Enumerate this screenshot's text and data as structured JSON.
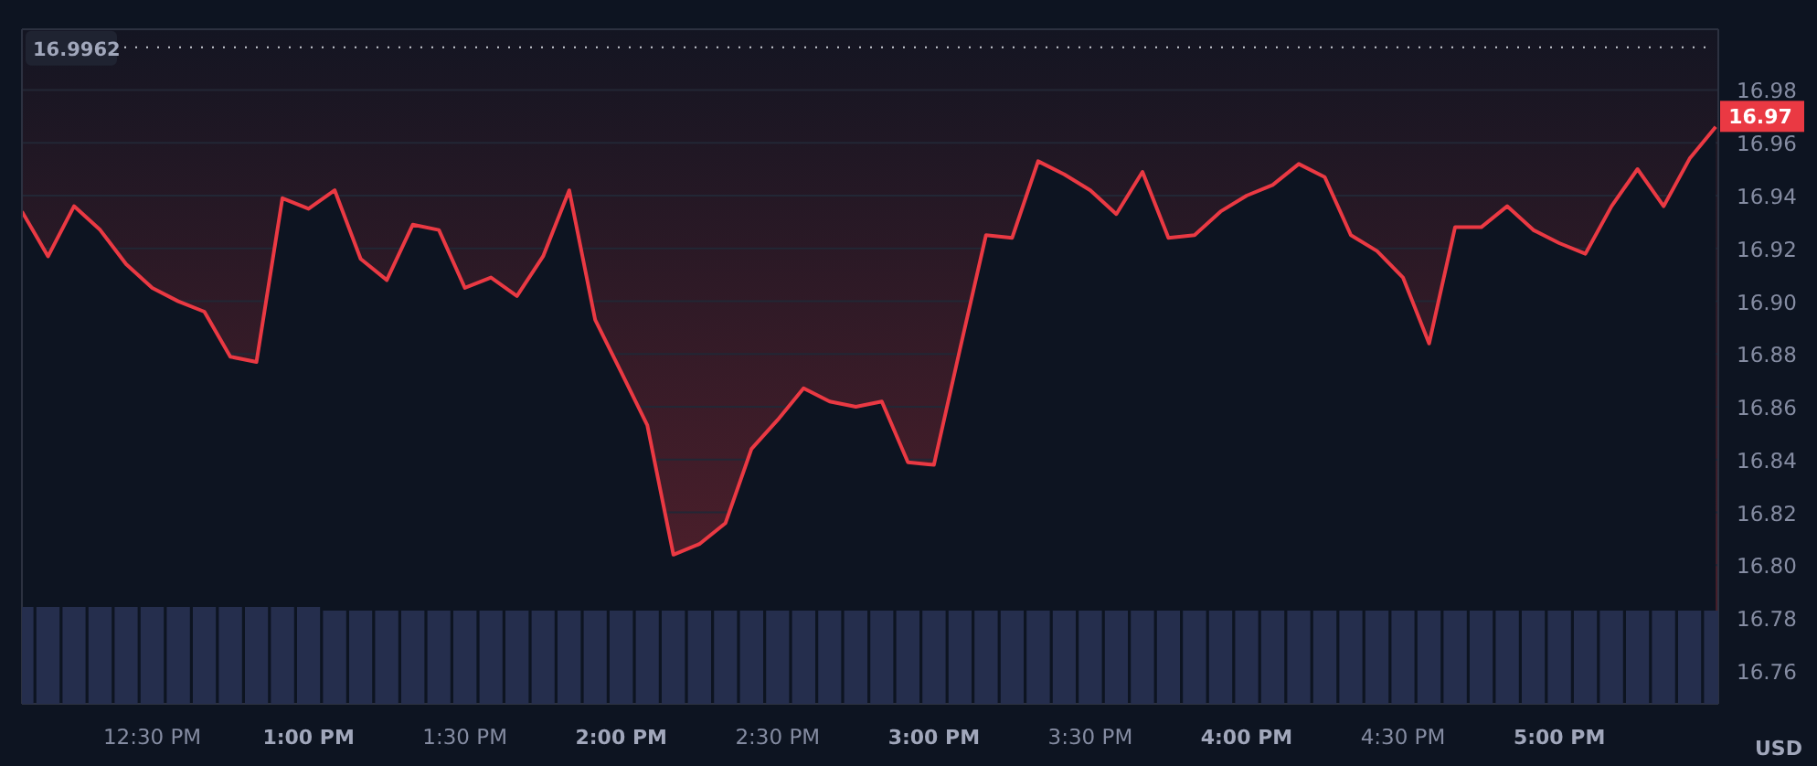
{
  "chart": {
    "chart_data": {
      "type": "area",
      "categories": [
        null,
        null,
        null,
        null,
        null,
        "12:30 PM",
        null,
        null,
        null,
        null,
        null,
        "1:00 PM",
        null,
        null,
        null,
        null,
        null,
        "1:30 PM",
        null,
        null,
        null,
        null,
        null,
        "2:00 PM",
        null,
        null,
        null,
        null,
        null,
        "2:30 PM",
        null,
        null,
        null,
        null,
        null,
        "3:00 PM",
        null,
        null,
        null,
        null,
        null,
        "3:30 PM",
        null,
        null,
        null,
        null,
        null,
        "4:00 PM",
        null,
        null,
        null,
        null,
        null,
        "4:30 PM",
        null,
        null,
        null,
        null,
        null,
        "5:00 PM",
        null,
        null,
        null,
        null,
        null,
        null
      ],
      "series": [
        {
          "color": "#ea3943",
          "values": [
            16.934,
            16.917,
            16.936,
            16.927,
            16.914,
            16.905,
            16.9,
            16.896,
            16.879,
            16.877,
            16.939,
            16.935,
            16.942,
            16.916,
            16.908,
            16.929,
            16.927,
            16.905,
            16.909,
            16.902,
            16.917,
            16.942,
            16.893,
            16.873,
            16.853,
            16.804,
            16.808,
            16.816,
            16.844,
            16.855,
            16.867,
            16.862,
            16.86,
            16.862,
            16.839,
            16.838,
            16.882,
            16.925,
            16.924,
            16.953,
            16.948,
            16.942,
            16.933,
            16.949,
            16.924,
            16.925,
            16.934,
            16.94,
            16.944,
            16.952,
            16.947,
            16.925,
            16.919,
            16.909,
            16.884,
            16.928,
            16.928,
            16.936,
            16.927,
            16.922,
            16.918,
            16.936,
            16.95,
            16.936,
            16.954,
            16.966
          ]
        }
      ],
      "ylim": [
        16.7475,
        17.003
      ],
      "grid": true,
      "yticks": [
        {
          "value": 16.76,
          "label": "16.76"
        },
        {
          "value": 16.78,
          "label": "16.78"
        },
        {
          "value": 16.8,
          "label": "16.80"
        },
        {
          "value": 16.82,
          "label": "16.82"
        },
        {
          "value": 16.84,
          "label": "16.84"
        },
        {
          "value": 16.86,
          "label": "16.86"
        },
        {
          "value": 16.88,
          "label": "16.88"
        },
        {
          "value": 16.9,
          "label": "16.90"
        },
        {
          "value": 16.92,
          "label": "16.92"
        },
        {
          "value": 16.94,
          "label": "16.94"
        },
        {
          "value": 16.96,
          "label": "16.96"
        },
        {
          "value": 16.98,
          "label": "16.98"
        }
      ]
    },
    "high_label": "16.9962",
    "last_price_label": "16.97"
  },
  "currency": "USD"
}
